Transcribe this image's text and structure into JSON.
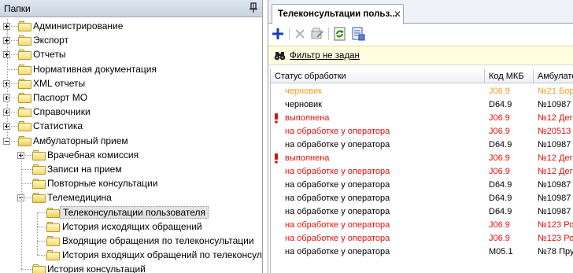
{
  "left_panel": {
    "title": "Папки",
    "tree": [
      {
        "label": "Администрирование",
        "level": 0,
        "expander": "plus"
      },
      {
        "label": "Экспорт",
        "level": 0,
        "expander": "plus"
      },
      {
        "label": "Отчеты",
        "level": 0,
        "expander": "plus"
      },
      {
        "label": "Нормативная документация",
        "level": 0,
        "expander": "none"
      },
      {
        "label": "XML отчеты",
        "level": 0,
        "expander": "plus"
      },
      {
        "label": "Паспорт МО",
        "level": 0,
        "expander": "plus"
      },
      {
        "label": "Справочники",
        "level": 0,
        "expander": "plus"
      },
      {
        "label": "Статистика",
        "level": 0,
        "expander": "plus"
      },
      {
        "label": "Амбулаторный прием",
        "level": 0,
        "expander": "minus"
      },
      {
        "label": "Врачебная комиссия",
        "level": 1,
        "expander": "plus"
      },
      {
        "label": "Записи на прием",
        "level": 1,
        "expander": "none"
      },
      {
        "label": "Повторные консультации",
        "level": 1,
        "expander": "none"
      },
      {
        "label": "Телемедицина",
        "level": 1,
        "expander": "minus"
      },
      {
        "label": "Телеконсультации пользователя",
        "level": 2,
        "expander": "none",
        "selected": true
      },
      {
        "label": "История исходящих обращений",
        "level": 2,
        "expander": "none"
      },
      {
        "label": "Входящие обращения по телеконсультации",
        "level": 2,
        "expander": "none"
      },
      {
        "label": "История входящих обращений по телеконсул",
        "level": 2,
        "expander": "none"
      },
      {
        "label": "История консультаций",
        "level": 1,
        "expander": "none"
      }
    ]
  },
  "tab": {
    "label": "Телеконсультации польз...",
    "close": "✕"
  },
  "toolbar": {
    "buttons": [
      "add-icon",
      "delete-icon",
      "edit-icon",
      "refresh-icon",
      "export-icon"
    ]
  },
  "filter": {
    "link_label": "Фильтр не задан"
  },
  "grid": {
    "columns": [
      "Статус обработки",
      "Код МКБ",
      "Амбулато"
    ],
    "rows": [
      {
        "status": "черновик",
        "mkb": "J06.9",
        "amb": "№21 Борх",
        "color": "#f0a020",
        "alert": false
      },
      {
        "status": "черновик",
        "mkb": "D64.9",
        "amb": "№10987 Я",
        "color": "#000000",
        "alert": false
      },
      {
        "status": "выполнена",
        "mkb": "J06.9",
        "amb": "№12 Дега",
        "color": "#e01010",
        "alert": true
      },
      {
        "status": "на обработке у оператора",
        "mkb": "J06.9",
        "amb": "№20513 Т",
        "color": "#e01010",
        "alert": false
      },
      {
        "status": "на обработке у оператора",
        "mkb": "D64.9",
        "amb": "№10987 Я",
        "color": "#000000",
        "alert": false
      },
      {
        "status": "выполнена",
        "mkb": "J06.9",
        "amb": "№12 Дега",
        "color": "#e01010",
        "alert": true
      },
      {
        "status": "на обработке у оператора",
        "mkb": "J06.9",
        "amb": "№12 Дега",
        "color": "#e01010",
        "alert": false
      },
      {
        "status": "на обработке у оператора",
        "mkb": "D64.9",
        "amb": "№10987 Я",
        "color": "#000000",
        "alert": false
      },
      {
        "status": "на обработке у оператора",
        "mkb": "D64.9",
        "amb": "№10987 Я",
        "color": "#000000",
        "alert": false
      },
      {
        "status": "на обработке у оператора",
        "mkb": "D64.9",
        "amb": "№10987 Я",
        "color": "#000000",
        "alert": false
      },
      {
        "status": "на обработке у оператора",
        "mkb": "J06.9",
        "amb": "№123 Ром",
        "color": "#e01010",
        "alert": false
      },
      {
        "status": "на обработке у оператора",
        "mkb": "J06.9",
        "amb": "№123 Ром",
        "color": "#e01010",
        "alert": false
      },
      {
        "status": "на обработке у оператора",
        "mkb": "M05.1",
        "amb": "№78 Прут",
        "color": "#000000",
        "alert": false
      }
    ]
  }
}
